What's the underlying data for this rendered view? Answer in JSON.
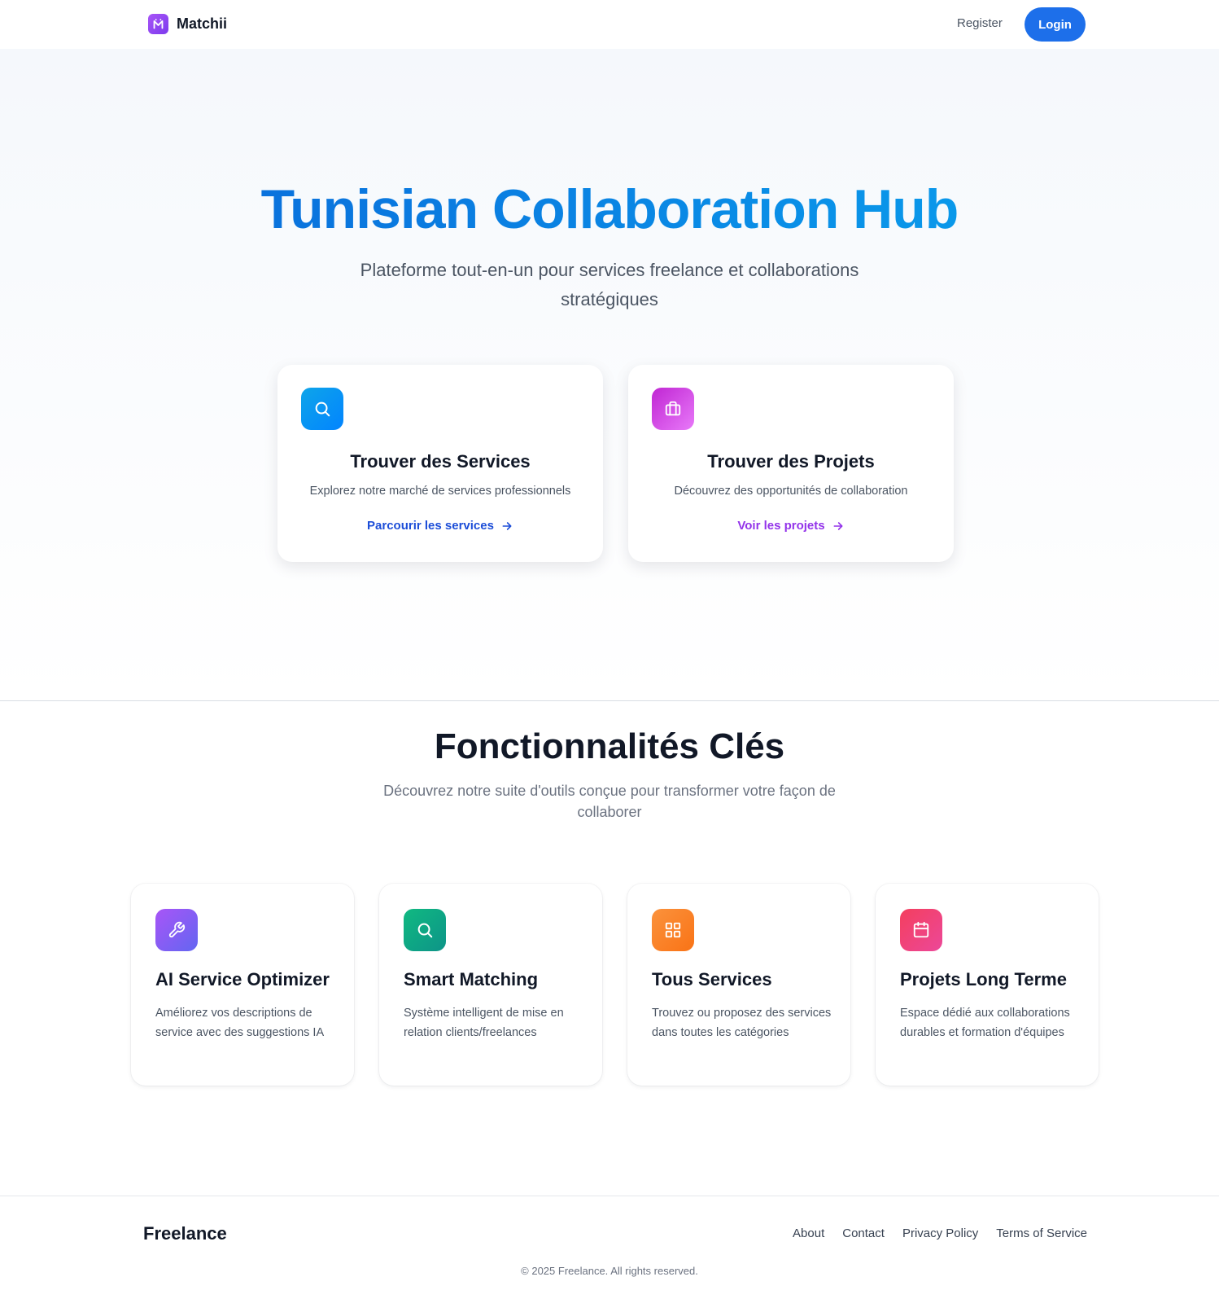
{
  "nav": {
    "brand": "Matchii",
    "register": "Register",
    "login": "Login"
  },
  "hero": {
    "title": "Tunisian Collaboration Hub",
    "subtitle": "Plateforme tout-en-un pour services freelance et collaborations stratégiques",
    "cards": [
      {
        "icon": "search-icon",
        "title": "Trouver des Services",
        "description": "Explorez notre marché de services professionnels",
        "link": "Parcourir les services"
      },
      {
        "icon": "briefcase-icon",
        "title": "Trouver des Projets",
        "description": "Découvrez des opportunités de collaboration",
        "link": "Voir les projets"
      }
    ]
  },
  "features": {
    "title": "Fonctionnalités Clés",
    "subtitle": "Découvrez notre suite d'outils conçue pour transformer votre façon de collaborer",
    "items": [
      {
        "icon": "wrench-icon",
        "title": "AI Service Optimizer",
        "description": "Améliorez vos descriptions de service avec des suggestions IA"
      },
      {
        "icon": "search-icon",
        "title": "Smart Matching",
        "description": "Système intelligent de mise en relation clients/freelances"
      },
      {
        "icon": "grid-icon",
        "title": "Tous Services",
        "description": "Trouvez ou proposez des services dans toutes les catégories"
      },
      {
        "icon": "calendar-icon",
        "title": "Projets Long Terme",
        "description": "Espace dédié aux collaborations durables et formation d'équipes"
      }
    ]
  },
  "footer": {
    "brand": "Freelance",
    "links": [
      "About",
      "Contact",
      "Privacy Policy",
      "Terms of Service"
    ],
    "copyright": "© 2025 Freelance. All rights reserved."
  },
  "colors": {
    "primary": "#1d6fea",
    "hero_title_start": "#0a64d8",
    "hero_title_end": "#0aa6ef",
    "projects_accent": "#9333ea"
  }
}
